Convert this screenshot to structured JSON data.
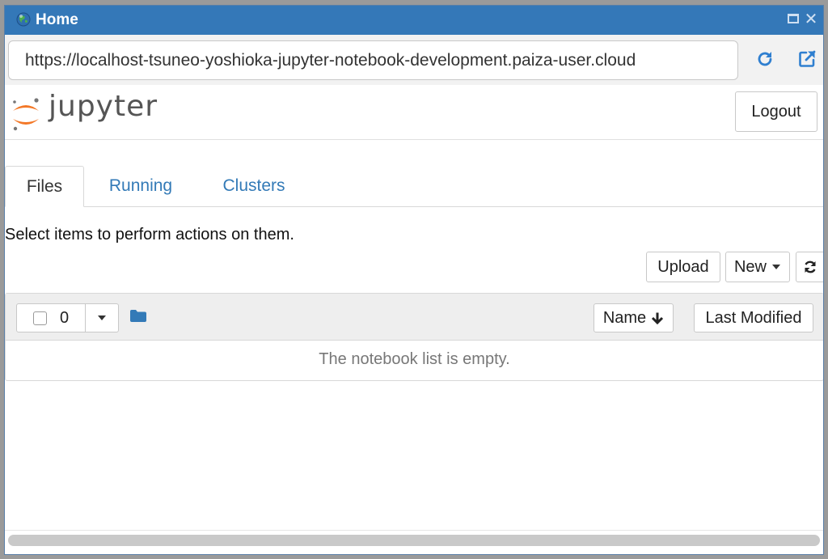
{
  "window": {
    "title": "Home",
    "icons": {
      "app": "globe-icon",
      "maximize": "maximize-icon",
      "close": "close-icon"
    },
    "close_glyph": "✕"
  },
  "browser": {
    "url": "https://localhost-tsuneo-yoshioka-jupyter-notebook-development.paiza-user.cloud",
    "icons": {
      "reload": "reload-icon",
      "open_external": "external-link-icon"
    }
  },
  "header": {
    "brand": "jupyter",
    "logout_label": "Logout"
  },
  "tabs": [
    {
      "label": "Files",
      "active": true
    },
    {
      "label": "Running",
      "active": false
    },
    {
      "label": "Clusters",
      "active": false
    }
  ],
  "files": {
    "select_message": "Select items to perform actions on them.",
    "toolbar": {
      "upload_label": "Upload",
      "new_label": "New",
      "refresh_icon": "refresh-icon"
    },
    "list_header": {
      "selected_count": "0",
      "name_sort_label": "Name",
      "last_modified_label": "Last Modified",
      "folder_icon": "folder-icon"
    },
    "empty_message": "The notebook list is empty."
  },
  "colors": {
    "titlebar": "#3478b8",
    "link": "#337ab7",
    "jupyter_orange": "#f37726"
  }
}
